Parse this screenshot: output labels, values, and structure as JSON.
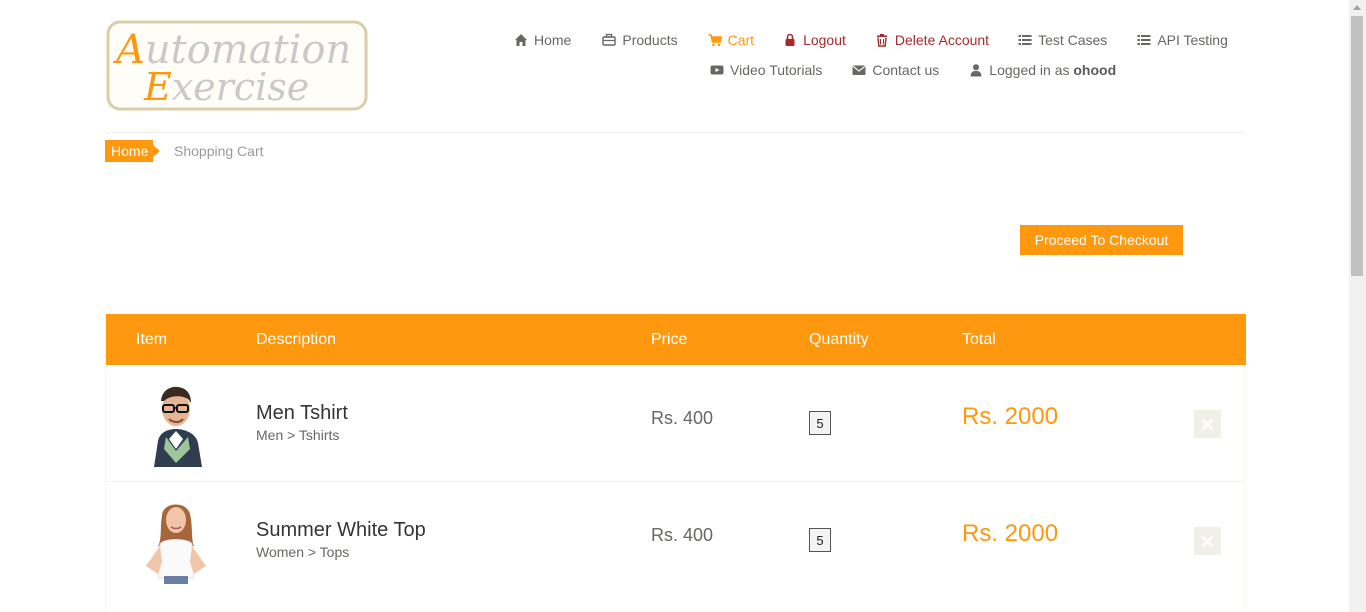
{
  "logo": {
    "line1": "Automation",
    "line2": "Exercise"
  },
  "nav": {
    "home": "Home",
    "products": "Products",
    "cart": "Cart",
    "logout": "Logout",
    "delete_account": "Delete Account",
    "test_cases": "Test Cases",
    "api_testing": "API Testing",
    "video_tutorials": "Video Tutorials",
    "contact_us": "Contact us",
    "logged_in_prefix": "Logged in as",
    "username": "ohood"
  },
  "breadcrumb": {
    "home": "Home",
    "current": "Shopping Cart"
  },
  "checkout": {
    "label": "Proceed To Checkout"
  },
  "table": {
    "headers": {
      "item": "Item",
      "description": "Description",
      "price": "Price",
      "quantity": "Quantity",
      "total": "Total"
    },
    "rows": [
      {
        "name": "Men Tshirt",
        "category": "Men > Tshirts",
        "price": "Rs. 400",
        "quantity": "5",
        "total": "Rs. 2000"
      },
      {
        "name": "Summer White Top",
        "category": "Women > Tops",
        "price": "Rs. 400",
        "quantity": "5",
        "total": "Rs. 2000"
      }
    ]
  },
  "colors": {
    "accent": "#FE980F",
    "danger": "#A52A2A",
    "text": "#696763"
  },
  "icons": {
    "home": "home-icon",
    "products": "briefcase-icon",
    "cart": "cart-icon",
    "logout": "lock-icon",
    "delete": "trash-icon",
    "test_cases": "list-icon",
    "api": "list-icon",
    "video": "youtube-icon",
    "contact": "envelope-icon",
    "user": "user-icon",
    "remove": "close-icon"
  }
}
